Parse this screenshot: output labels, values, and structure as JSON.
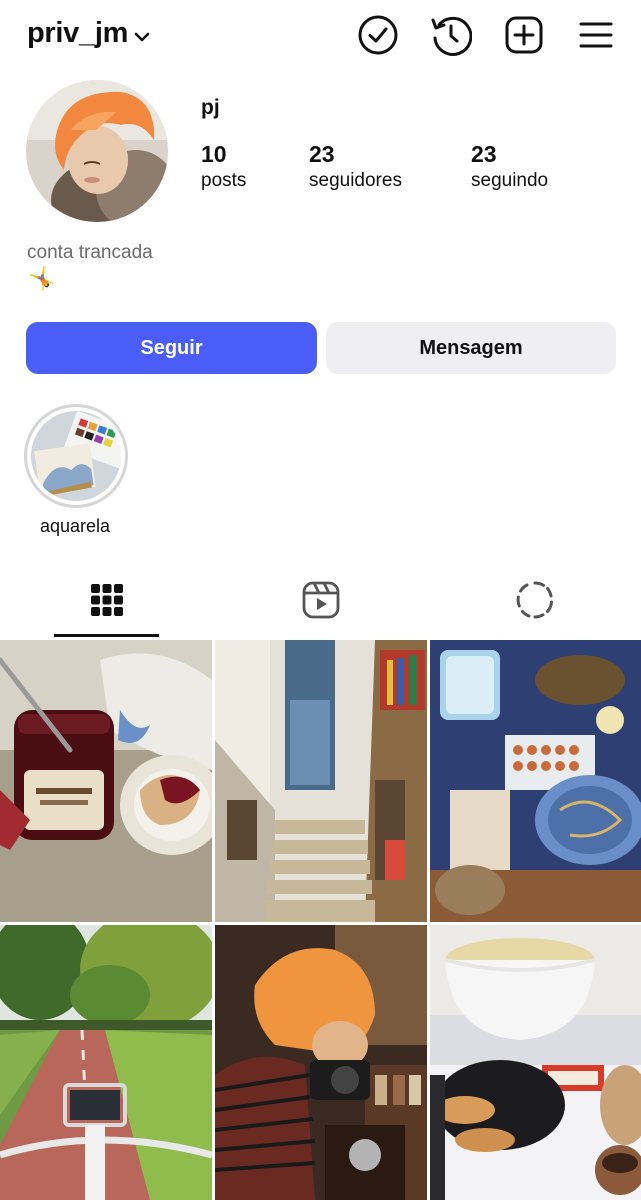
{
  "header": {
    "username": "priv_jm",
    "icons": [
      "check-circle-icon",
      "history-icon",
      "add-post-icon",
      "menu-icon"
    ]
  },
  "profile": {
    "display_name": "pj",
    "stats": [
      {
        "value": "10",
        "label": "posts"
      },
      {
        "value": "23",
        "label": "seguidores"
      },
      {
        "value": "23",
        "label": "seguindo"
      }
    ],
    "bio_line1": "conta trancada",
    "bio_emoji": "🤸"
  },
  "actions": {
    "follow_label": "Seguir",
    "message_label": "Mensagem"
  },
  "highlights": [
    {
      "label": "aquarela"
    }
  ],
  "tabs": [
    "grid-icon",
    "reels-icon",
    "tagged-loading-icon"
  ],
  "colors": {
    "follow_button": "#4a5df9",
    "message_button": "#efeff1",
    "secondary_text": "#6b6b6b"
  },
  "grid_posts": [
    {
      "name": "post-jam-jar"
    },
    {
      "name": "post-bookshop-stairs"
    },
    {
      "name": "post-jewelry-table"
    },
    {
      "name": "post-park-bike-path"
    },
    {
      "name": "post-person-camera"
    },
    {
      "name": "post-pancakes-stove"
    }
  ]
}
